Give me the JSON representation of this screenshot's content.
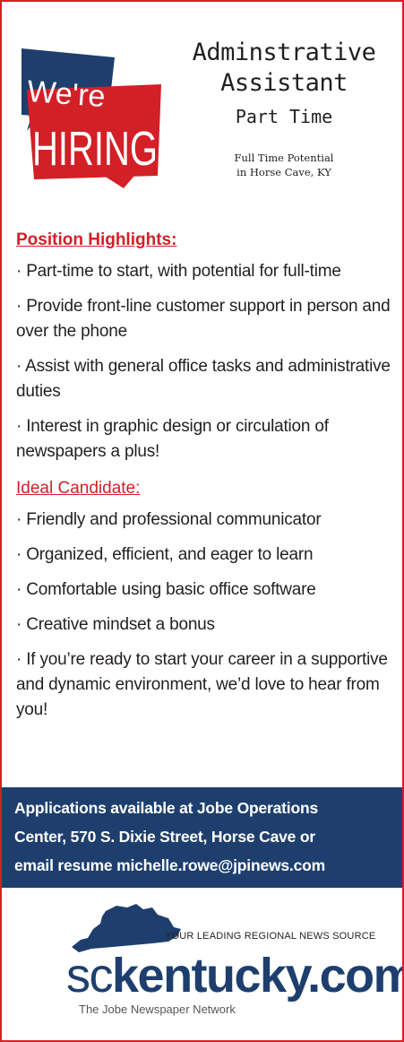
{
  "badge": {
    "line1": "We're",
    "line2": "HIRING",
    "color_dark": "#1e3f6e",
    "color_red": "#d32027"
  },
  "header": {
    "title_line1": "Adminstrative",
    "title_line2": "Assistant",
    "subtitle": "Part Time",
    "note_line1": "Full Time Potential",
    "note_line2": "in Horse Cave, KY"
  },
  "highlights": {
    "heading": "Position Highlights:",
    "items": [
      "· Part-time to start, with potential for full-time",
      "· Provide front-line customer support in person and over the phone",
      "· Assist with general office tasks and administrative duties",
      "· Interest in graphic design or circulation of newspapers a plus!"
    ]
  },
  "candidate": {
    "heading": "Ideal Candidate:",
    "items": [
      "· Friendly and professional communicator",
      "· Organized, efficient, and eager to learn",
      "· Comfortable using basic office software",
      "· Creative mindset a bonus",
      "· If you’re ready to start your career in a supportive and dynamic environment, we’d love to hear from you!"
    ]
  },
  "band": {
    "line1": "Applications available at Jobe Operations",
    "line2": "Center, 570 S. Dixie Street, Horse Cave or",
    "line3": "email resume michelle.rowe@jpinews.com"
  },
  "footer": {
    "tagline": "YOUR LEADING REGIONAL NEWS SOURCE",
    "logo_prefix": "sc",
    "logo_main": "kentucky.com",
    "logo_subtitle": "The Jobe Newspaper Network"
  },
  "colors": {
    "accent_red": "#d32027",
    "navy": "#1e3f6e",
    "text": "#231f20"
  }
}
